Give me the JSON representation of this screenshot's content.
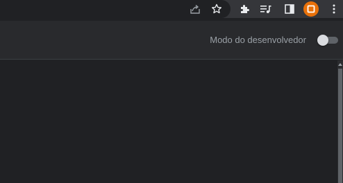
{
  "toolbar": {
    "icons": [
      "share-icon",
      "bookmark-star-icon",
      "extensions-icon",
      "media-queue-icon",
      "side-panel-icon",
      "profile-avatar-icon",
      "more-menu-icon"
    ],
    "accent": "#e8710a"
  },
  "header": {
    "developer_mode_label": "Modo do desenvolvedor",
    "developer_mode_enabled": false
  },
  "colors": {
    "background": "#202124",
    "header": "#292a2d",
    "toolbar": "#35363a",
    "text_secondary": "#9aa0a6"
  }
}
